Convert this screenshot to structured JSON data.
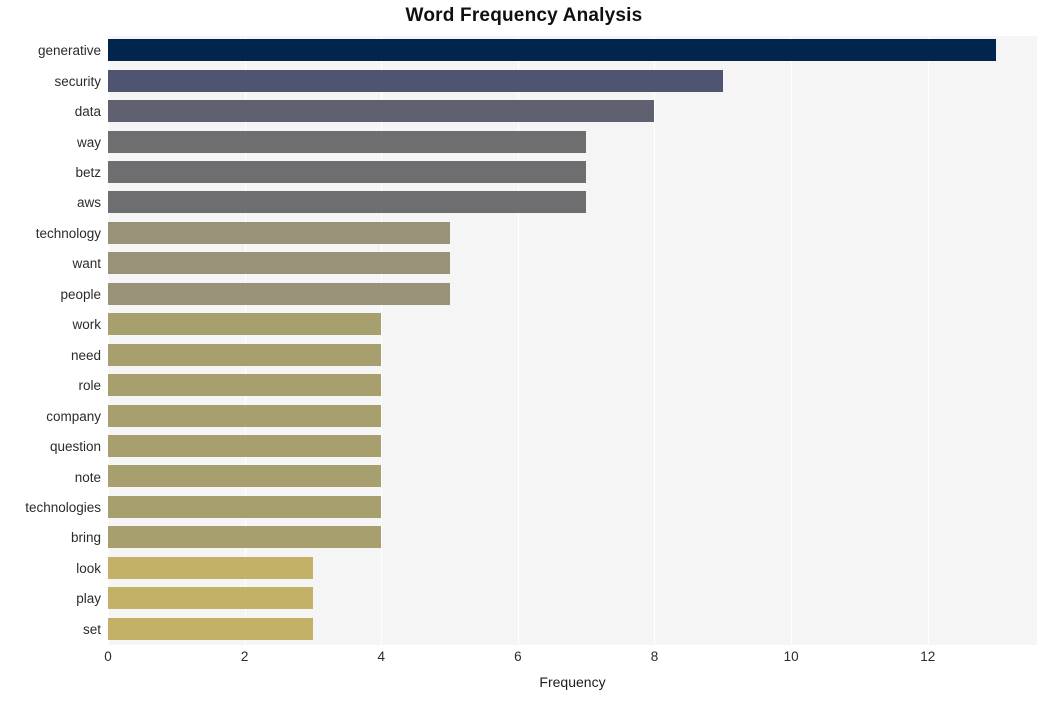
{
  "chart_data": {
    "type": "bar",
    "orientation": "horizontal",
    "title": "Word Frequency Analysis",
    "xlabel": "Frequency",
    "ylabel": "",
    "categories": [
      "generative",
      "security",
      "data",
      "way",
      "betz",
      "aws",
      "technology",
      "want",
      "people",
      "work",
      "need",
      "role",
      "company",
      "question",
      "note",
      "technologies",
      "bring",
      "look",
      "play",
      "set"
    ],
    "values": [
      13,
      9,
      8,
      7,
      7,
      7,
      5,
      5,
      5,
      4,
      4,
      4,
      4,
      4,
      4,
      4,
      4,
      3,
      3,
      3
    ],
    "bar_colors": [
      "#02254d",
      "#4f5470",
      "#5f6070",
      "#6e6e70",
      "#6e6e70",
      "#6e6e70",
      "#989279",
      "#989279",
      "#989279",
      "#a89f6f",
      "#a89f6f",
      "#a89f6f",
      "#a89f6f",
      "#a89f6f",
      "#a89f6f",
      "#a89f6f",
      "#a89f6f",
      "#c3b168",
      "#c3b168",
      "#c3b168"
    ],
    "xlim": [
      0,
      13.6
    ],
    "xticks": [
      0,
      2,
      4,
      6,
      8,
      10,
      12
    ],
    "xtick_labels": [
      "0",
      "2",
      "4",
      "6",
      "8",
      "10",
      "12"
    ],
    "grid": true,
    "grid_axis": "x",
    "grid_color": "#ffffff",
    "plot_background": "#f5f5f6",
    "figure_background": "#ffffff",
    "legend": null
  }
}
